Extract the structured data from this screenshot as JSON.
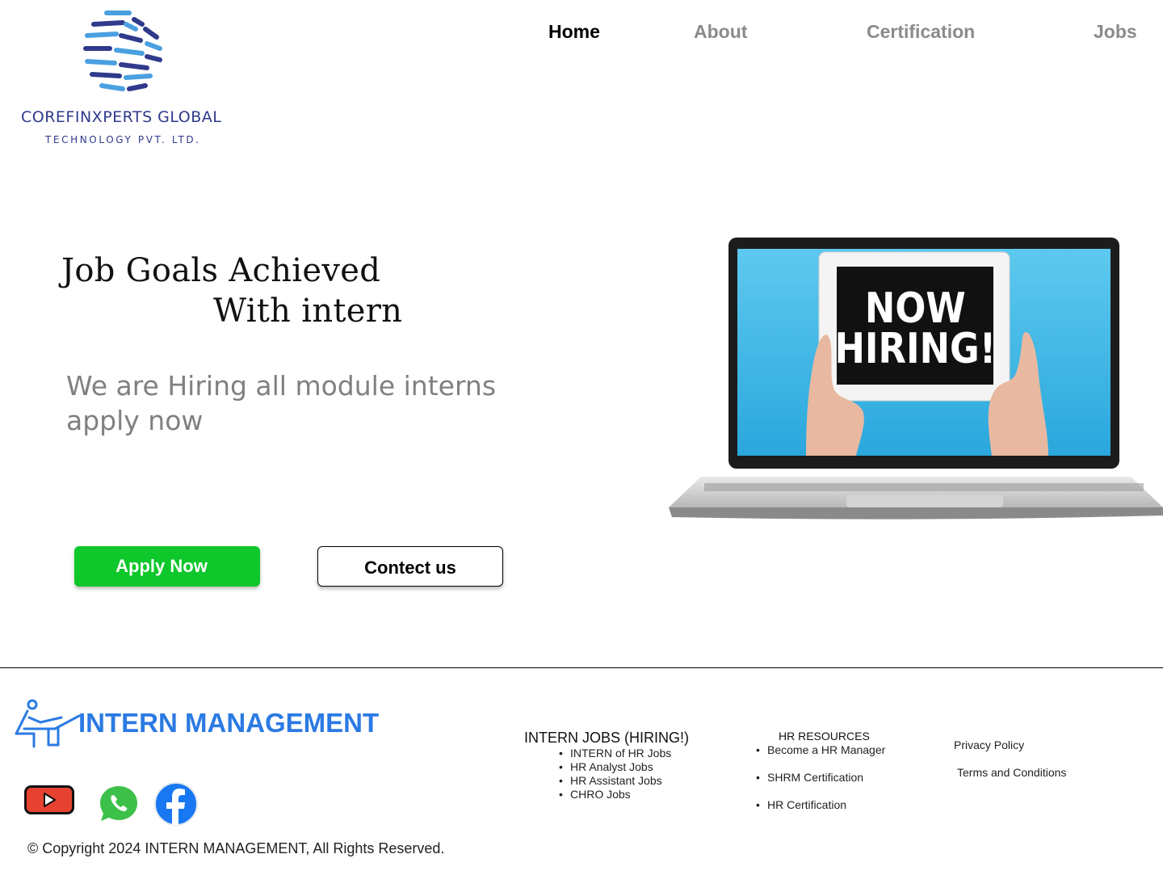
{
  "header": {
    "brand_name": "COREFINXPERTS GLOBAL",
    "brand_sub": "TECHNOLOGY PVT. LTD.",
    "nav": [
      {
        "label": "Home",
        "active": true
      },
      {
        "label": "About",
        "active": false
      },
      {
        "label": "Certification",
        "active": false
      },
      {
        "label": "Jobs",
        "active": false
      }
    ]
  },
  "hero": {
    "title_line1": "Job Goals Achieved",
    "title_line2": "With intern",
    "subtitle": "We are Hiring all module interns apply now",
    "apply_label": "Apply Now",
    "contact_label": "Contect us",
    "image_text_line1": "NOW",
    "image_text_line2": "HIRING!"
  },
  "footer": {
    "brand": "INTERN MANAGEMENT",
    "jobs_title": "INTERN JOBS (HIRING!)",
    "jobs_items": [
      "INTERN of HR Jobs",
      "HR Analyst Jobs",
      "HR Assistant Jobs",
      "CHRO Jobs"
    ],
    "resources_title": "HR RESOURCES",
    "resources_items": [
      "Become a HR Manager",
      "SHRM Certification",
      "HR Certification"
    ],
    "privacy": "Privacy Policy",
    "terms": "Terms and Conditions",
    "copyright": "© Copyright 2024 INTERN MANAGEMENT, All Rights Reserved.",
    "social": [
      "youtube-icon",
      "whatsapp-icon",
      "facebook-icon"
    ]
  },
  "colors": {
    "accent_green": "#0ec72b",
    "brand_blue": "#2b7ae3",
    "logo_navy": "#2f3a8c",
    "nav_gray": "#8b8b8b"
  }
}
